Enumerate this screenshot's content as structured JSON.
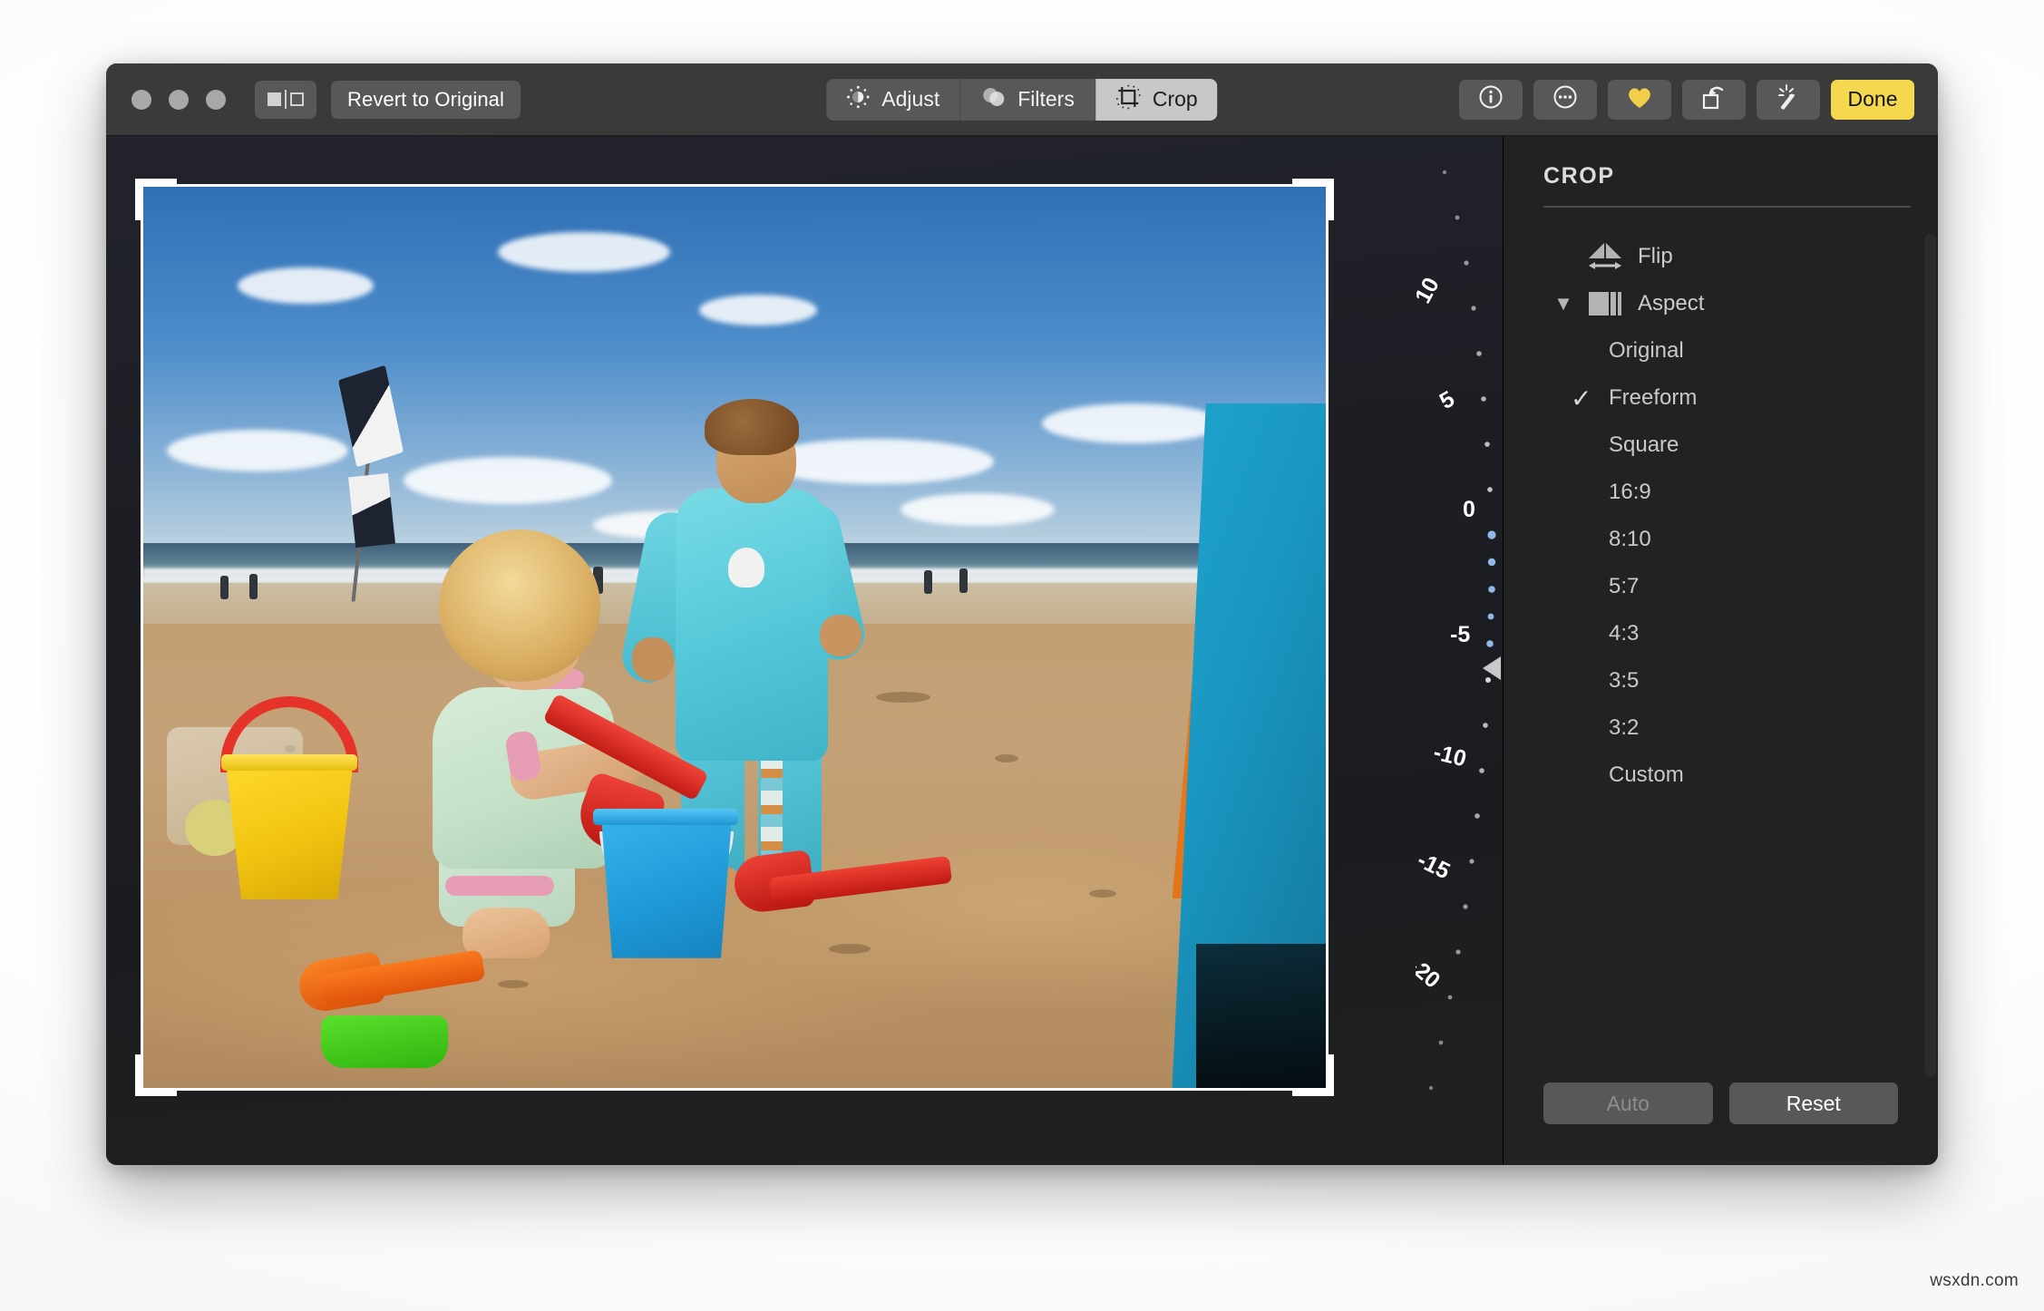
{
  "window": {
    "traffic_lights": [
      "close",
      "minimize",
      "zoom"
    ]
  },
  "toolbar": {
    "compare_button_name": "compare-original",
    "revert_label": "Revert to Original",
    "modes": [
      {
        "label": "Adjust",
        "icon": "brightness-icon",
        "active": false
      },
      {
        "label": "Filters",
        "icon": "filters-circles-icon",
        "active": false
      },
      {
        "label": "Crop",
        "icon": "crop-icon",
        "active": true
      }
    ],
    "right_buttons": [
      {
        "name": "info-button",
        "icon": "info-circle-icon"
      },
      {
        "name": "more-button",
        "icon": "ellipsis-circle-icon"
      },
      {
        "name": "favorite-button",
        "icon": "heart-icon"
      },
      {
        "name": "rotate-button",
        "icon": "rotate-left-icon"
      },
      {
        "name": "enhance-button",
        "icon": "magic-wand-icon"
      }
    ],
    "done_label": "Done"
  },
  "sidebar": {
    "title": "CROP",
    "flip": {
      "label": "Flip",
      "icon": "flip-horizontal-icon"
    },
    "aspect": {
      "label": "Aspect",
      "icon": "aspect-icon",
      "expanded": true,
      "disclosure": "▼"
    },
    "aspect_options": [
      {
        "label": "Original",
        "selected": false
      },
      {
        "label": "Freeform",
        "selected": true
      },
      {
        "label": "Square",
        "selected": false
      },
      {
        "label": "16:9",
        "selected": false
      },
      {
        "label": "8:10",
        "selected": false
      },
      {
        "label": "5:7",
        "selected": false
      },
      {
        "label": "4:3",
        "selected": false
      },
      {
        "label": "3:5",
        "selected": false
      },
      {
        "label": "3:2",
        "selected": false
      },
      {
        "label": "Custom",
        "selected": false
      }
    ],
    "checkmark": "✓",
    "auto_label": "Auto",
    "reset_label": "Reset"
  },
  "straighten": {
    "name": "straighten-dial",
    "tick_labels": [
      "10",
      "5",
      "0",
      "-5",
      "-10",
      "-15",
      "-20"
    ],
    "value": -4,
    "unit": "degrees"
  },
  "colors": {
    "accent_done": "#f6d84e",
    "favorite_heart": "#f2cf4a",
    "toolbar_bg": "#3a3a3a",
    "sidebar_bg": "#222222",
    "segment_active_bg": "#c8c8c8"
  },
  "watermark": {
    "text": "wsxdn.com"
  }
}
